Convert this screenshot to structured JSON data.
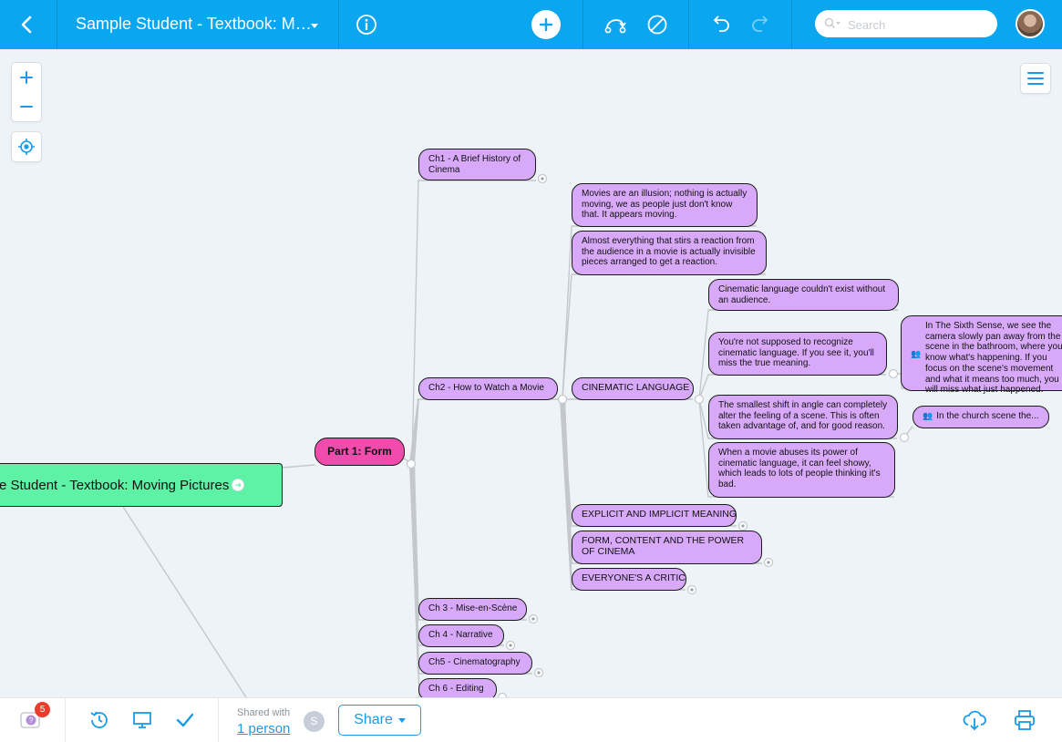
{
  "toolbar": {
    "title": "Sample Student - Textbook: M…",
    "search_placeholder": "Search",
    "accent_color": "#0aa6f0",
    "icons": [
      "chevron-left-icon",
      "caret-down-icon",
      "info-icon",
      "plus-icon",
      "relation-icon",
      "no-entry-icon",
      "undo-icon",
      "redo-icon",
      "search-icon",
      "avatar"
    ]
  },
  "map_controls": {
    "zoom_in": "+",
    "zoom_out": "−",
    "icons": [
      "plus-icon",
      "minus-icon",
      "locate-icon",
      "outline-menu-icon"
    ]
  },
  "mindmap": {
    "root": "e Student - Textbook: Moving Pictures",
    "part": "Part 1: Form",
    "chapters": {
      "ch1": "Ch1 - A Brief History of Cinema",
      "ch2": "Ch2 - How to Watch a Movie",
      "ch3": "Ch 3 - Mise-en-Scène",
      "ch4": "Ch 4 - Narrative",
      "ch5": "Ch5 - Cinematography",
      "ch6": "Ch 6 - Editing"
    },
    "ch2_topics": {
      "illusion": "Movies are an illusion; nothing is actually moving, we as people just don't know that. It appears moving.",
      "invisible": "Almost everything that stirs a reaction from the audience in a movie is actually invisible pieces arranged to get a reaction.",
      "cinematic_language": "CINEMATIC LANGUAGE",
      "explicit": "EXPLICIT AND IMPLICIT MEANING",
      "form_content": "FORM, CONTENT AND THE POWER OF CINEMA",
      "critic": "EVERYONE'S A CRITIC"
    },
    "cinematic_children": {
      "audience": "Cinematic language couldn't exist without an audience.",
      "not_supposed": "You're not supposed to recognize cinematic language. If you see it, you'll miss the true meaning.",
      "smallest_shift": "The smallest shift in angle can completely alter the feeling of a scene. This is often taken advantage of, and for good reason.",
      "abuses": "When a movie abuses its power of cinematic language, it can feel showy, which leads to lots of people thinking it's bad."
    },
    "examples": {
      "sixth_sense": "In The Sixth Sense, we see the camera slowly pan away from the scene in the bathroom, where you know what's happening. If you focus on the scene's movement and what it means too much, you will miss what just happened.",
      "church": "In the church scene the..."
    },
    "colors": {
      "root": "#5ef2a6",
      "part": "#f14bae",
      "topic": "#d8a9f8"
    }
  },
  "bottombar": {
    "help_count": "5",
    "shared_with_label": "Shared with",
    "shared_count_link": "1 person",
    "user_initial": "S",
    "share_label": "Share",
    "icons": [
      "help-icon",
      "history-icon",
      "presentation-icon",
      "checkmark-icon",
      "cloud-download-icon",
      "print-icon"
    ]
  }
}
